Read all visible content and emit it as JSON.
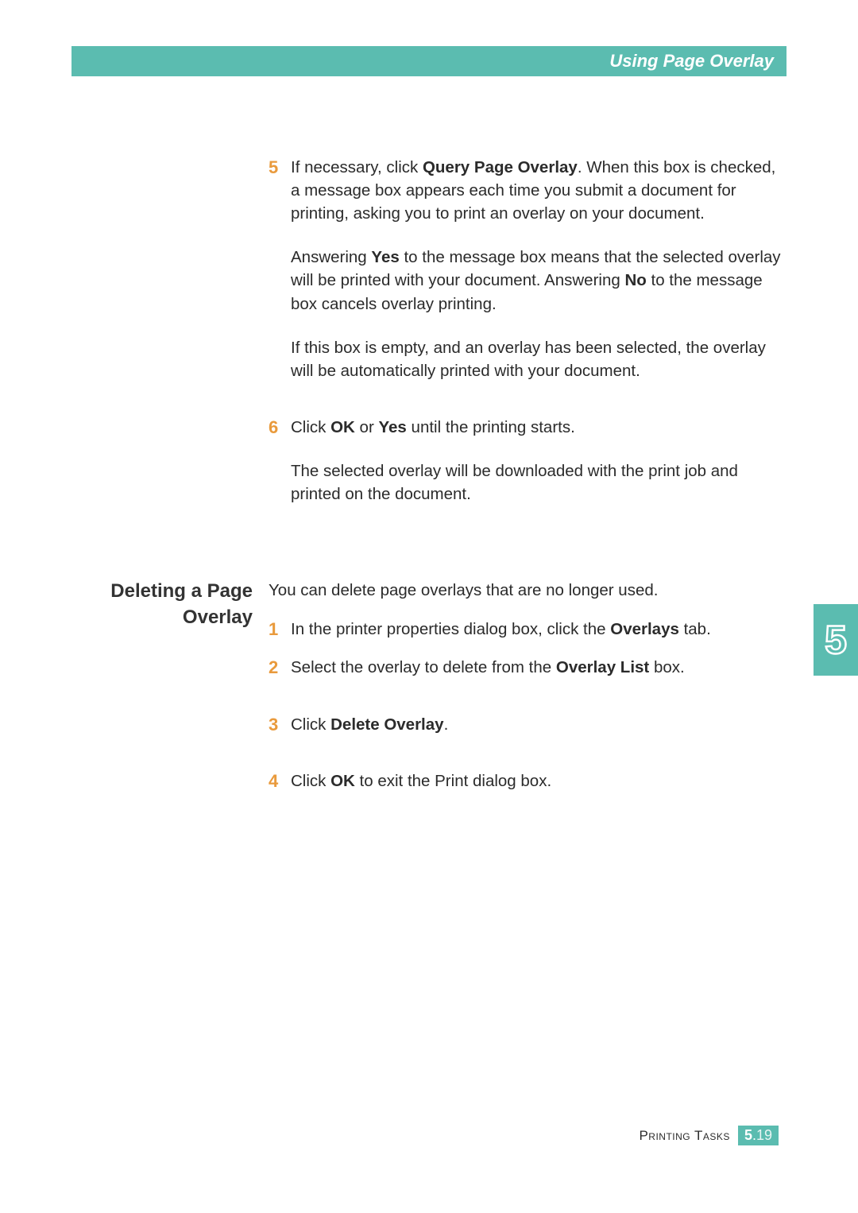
{
  "header": {
    "title": "Using Page Overlay"
  },
  "steps_a": [
    {
      "num": "5",
      "paras": [
        "If necessary, click <b>Query Page Overlay</b>. When this box is checked, a message box appears each time you submit a document for printing, asking you to print an overlay on your document.",
        "Answering <b>Yes</b> to the message box means that the selected overlay will be printed with your document. Answering <b>No</b> to the message box cancels overlay printing.",
        "If this box is empty, and an overlay has been selected, the overlay will be automatically printed with your document."
      ]
    },
    {
      "num": "6",
      "paras": [
        "Click <b>OK</b> or <b>Yes</b> until the printing starts.",
        "The selected overlay will be downloaded with the print job and printed on the document."
      ]
    }
  ],
  "section2": {
    "heading": "Deleting a Page Overlay",
    "intro": "You can delete page overlays that are no longer used.",
    "steps": [
      {
        "num": "1",
        "text": "In the printer properties dialog box, click the <b>Overlays</b> tab."
      },
      {
        "num": "2",
        "text": "Select the overlay to delete from the <b>Overlay List</b> box."
      },
      {
        "num": "3",
        "text": "Click <b>Delete Overlay</b>."
      },
      {
        "num": "4",
        "text": "Click <b>OK</b> to exit the Print dialog box."
      }
    ]
  },
  "side_tab": "5",
  "footer": {
    "label": "Printing Tasks",
    "chapter": "5",
    "page": "19"
  }
}
